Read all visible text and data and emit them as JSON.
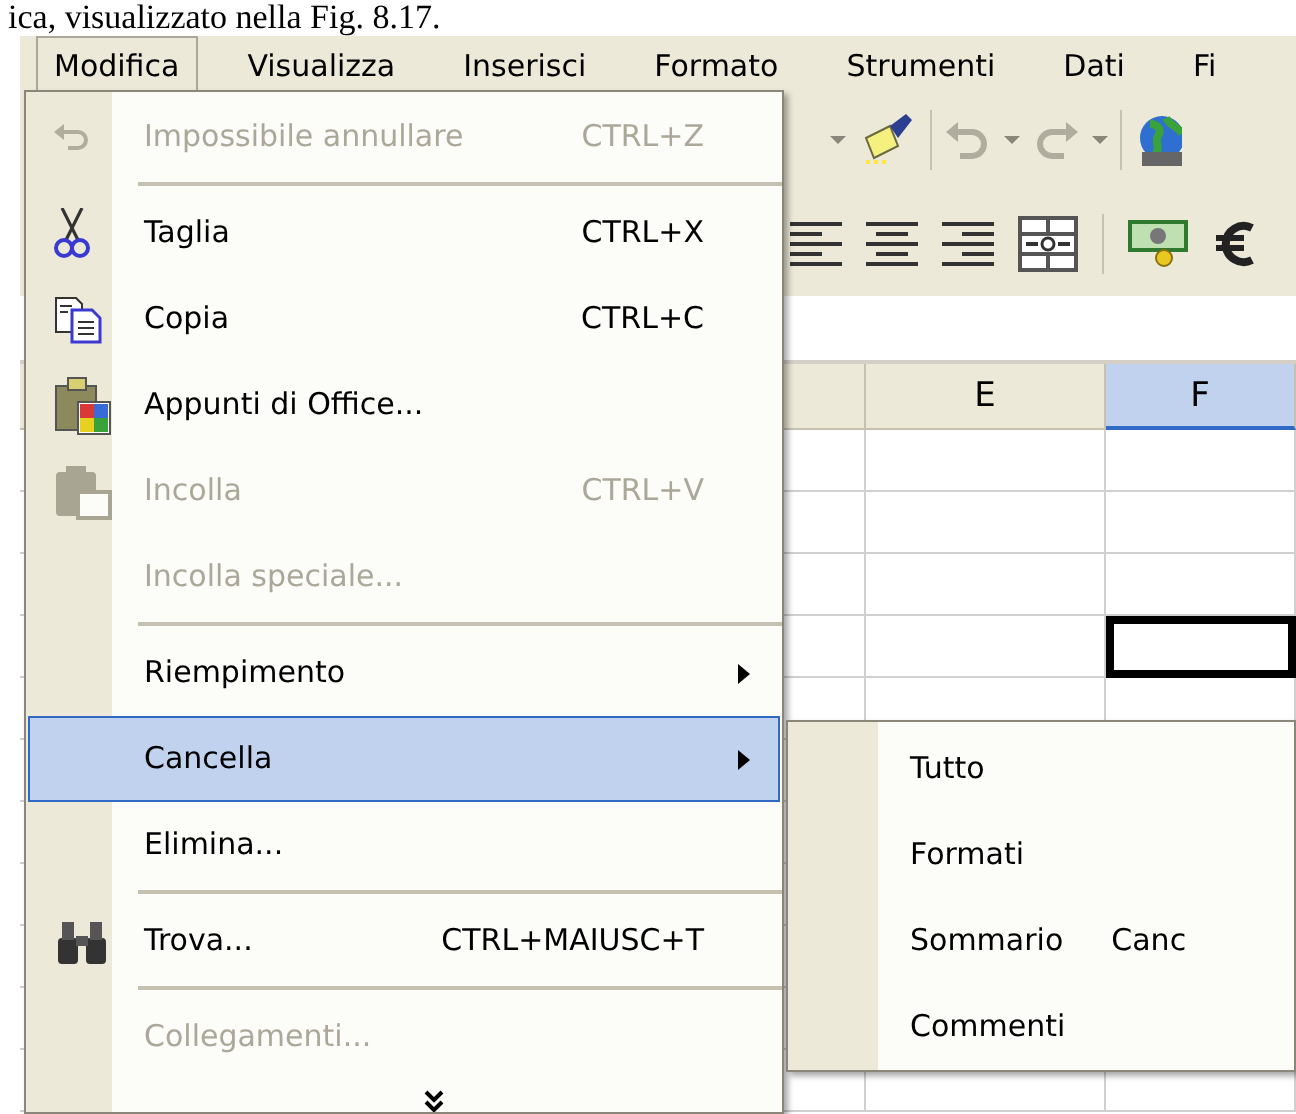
{
  "caption": "ica, visualizzato nella Fig. 8.17.",
  "menubar": [
    {
      "label": "Modifica",
      "selected": true
    },
    {
      "label": "Visualizza",
      "selected": false
    },
    {
      "label": "Inserisci",
      "selected": false
    },
    {
      "label": "Formato",
      "selected": false
    },
    {
      "label": "Strumenti",
      "selected": false
    },
    {
      "label": "Dati",
      "selected": false
    },
    {
      "label": "Fi",
      "selected": false
    }
  ],
  "edit_menu": [
    {
      "kind": "item",
      "label": "Impossibile annullare",
      "shortcut": "CTRL+Z",
      "disabled": true,
      "selected": false,
      "submenu": false
    },
    {
      "kind": "separator"
    },
    {
      "kind": "item",
      "label": "Taglia",
      "shortcut": "CTRL+X",
      "disabled": false,
      "selected": false,
      "submenu": false
    },
    {
      "kind": "item",
      "label": "Copia",
      "shortcut": "CTRL+C",
      "disabled": false,
      "selected": false,
      "submenu": false
    },
    {
      "kind": "item",
      "label": "Appunti di Office...",
      "disabled": false,
      "selected": false,
      "submenu": false
    },
    {
      "kind": "item",
      "label": "Incolla",
      "shortcut": "CTRL+V",
      "disabled": true,
      "selected": false,
      "submenu": false
    },
    {
      "kind": "item",
      "label": "Incolla speciale...",
      "disabled": true,
      "selected": false,
      "submenu": false
    },
    {
      "kind": "separator"
    },
    {
      "kind": "item",
      "label": "Riempimento",
      "disabled": false,
      "selected": false,
      "submenu": true
    },
    {
      "kind": "item",
      "label": "Cancella",
      "disabled": false,
      "selected": true,
      "submenu": true
    },
    {
      "kind": "item",
      "label": "Elimina...",
      "disabled": false,
      "selected": false,
      "submenu": false
    },
    {
      "kind": "separator"
    },
    {
      "kind": "item",
      "label": "Trova...",
      "shortcut": "CTRL+MAIUSC+T",
      "disabled": false,
      "selected": false,
      "submenu": false
    },
    {
      "kind": "separator"
    },
    {
      "kind": "item",
      "label": "Collegamenti...",
      "disabled": true,
      "selected": false,
      "submenu": false
    },
    {
      "kind": "expand"
    }
  ],
  "submenu": [
    {
      "label": "Tutto"
    },
    {
      "label": "Formati"
    },
    {
      "label": "Sommario",
      "shortcut": "Canc"
    },
    {
      "label": "Commenti"
    }
  ],
  "sheet": {
    "columns": [
      {
        "label": "E",
        "selected": false
      },
      {
        "label": "F",
        "selected": true
      }
    ],
    "rows": [
      {
        "active": false
      },
      {
        "active": false
      },
      {
        "active": false
      },
      {
        "active": true
      }
    ]
  }
}
